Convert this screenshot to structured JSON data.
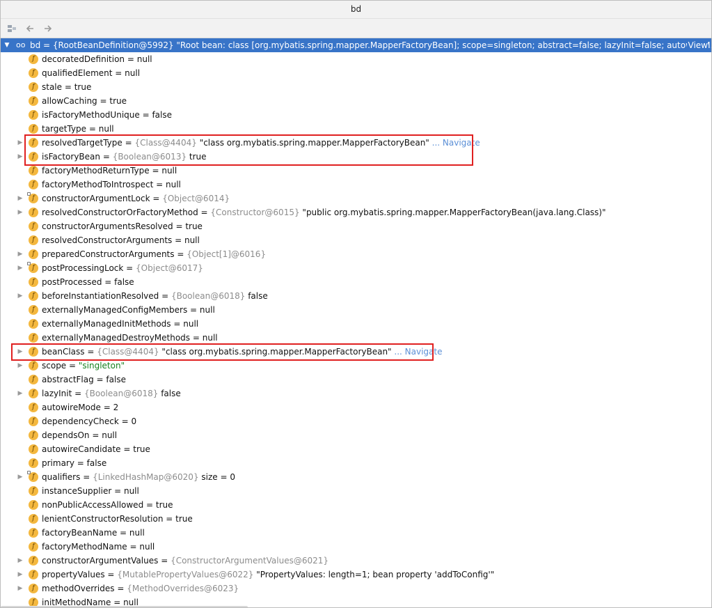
{
  "window": {
    "title": "bd"
  },
  "toolbar": {
    "buttons": [
      {
        "name": "restore-layout-icon"
      },
      {
        "name": "back-arrow-icon"
      },
      {
        "name": "forward-arrow-icon"
      }
    ]
  },
  "root": {
    "label": "bd = {RootBeanDefinition@5992} \"Root bean: class [org.mybatis.spring.mapper.MapperFactoryBean]; scope=singleton; abstract=false; lazyInit=false; autowireM...",
    "view": "View"
  },
  "fields": [
    {
      "name": "decoratedDefinition",
      "eq": " = ",
      "value": "null"
    },
    {
      "name": "qualifiedElement",
      "eq": " = ",
      "value": "null"
    },
    {
      "name": "stale",
      "eq": " = ",
      "value": "true"
    },
    {
      "name": "allowCaching",
      "eq": " = ",
      "value": "true"
    },
    {
      "name": "isFactoryMethodUnique",
      "eq": " = ",
      "value": "false"
    },
    {
      "name": "targetType",
      "eq": " = ",
      "value": "null"
    },
    {
      "name": "resolvedTargetType",
      "eq": " = ",
      "ref": "{Class@4404}",
      "value": " \"class org.mybatis.spring.mapper.MapperFactoryBean\"",
      "nav": " ... Navigate"
    },
    {
      "name": "isFactoryBean",
      "eq": " = ",
      "ref": "{Boolean@6013}",
      "value": " true"
    },
    {
      "name": "factoryMethodReturnType",
      "eq": " = ",
      "value": "null"
    },
    {
      "name": "factoryMethodToIntrospect",
      "eq": " = ",
      "value": "null"
    },
    {
      "name": "constructorArgumentLock",
      "eq": " = ",
      "ref": "{Object@6014}",
      "value": ""
    },
    {
      "name": "resolvedConstructorOrFactoryMethod",
      "eq": " = ",
      "ref": "{Constructor@6015}",
      "value": " \"public org.mybatis.spring.mapper.MapperFactoryBean(java.lang.Class)\""
    },
    {
      "name": "constructorArgumentsResolved",
      "eq": " = ",
      "value": "true"
    },
    {
      "name": "resolvedConstructorArguments",
      "eq": " = ",
      "value": "null"
    },
    {
      "name": "preparedConstructorArguments",
      "eq": " = ",
      "ref": "{Object[1]@6016}",
      "value": ""
    },
    {
      "name": "postProcessingLock",
      "eq": " = ",
      "ref": "{Object@6017}",
      "value": ""
    },
    {
      "name": "postProcessed",
      "eq": " = ",
      "value": "false"
    },
    {
      "name": "beforeInstantiationResolved",
      "eq": " = ",
      "ref": "{Boolean@6018}",
      "value": " false"
    },
    {
      "name": "externallyManagedConfigMembers",
      "eq": " = ",
      "value": "null"
    },
    {
      "name": "externallyManagedInitMethods",
      "eq": " = ",
      "value": "null"
    },
    {
      "name": "externallyManagedDestroyMethods",
      "eq": " = ",
      "value": "null"
    },
    {
      "name": "beanClass",
      "eq": " = ",
      "ref": "{Class@4404}",
      "value": " \"class org.mybatis.spring.mapper.MapperFactoryBean\"",
      "nav": " ... Navigate"
    },
    {
      "name": "scope",
      "eq": " = ",
      "str": "\"singleton\"",
      "value": ""
    },
    {
      "name": "abstractFlag",
      "eq": " = ",
      "value": "false"
    },
    {
      "name": "lazyInit",
      "eq": " = ",
      "ref": "{Boolean@6018}",
      "value": " false"
    },
    {
      "name": "autowireMode",
      "eq": " = ",
      "value": "2"
    },
    {
      "name": "dependencyCheck",
      "eq": " = ",
      "value": "0"
    },
    {
      "name": "dependsOn",
      "eq": " = ",
      "value": "null"
    },
    {
      "name": "autowireCandidate",
      "eq": " = ",
      "value": "true"
    },
    {
      "name": "primary",
      "eq": " = ",
      "value": "false"
    },
    {
      "name": "qualifiers",
      "eq": " = ",
      "ref": "{LinkedHashMap@6020}",
      "value": "  size = 0"
    },
    {
      "name": "instanceSupplier",
      "eq": " = ",
      "value": "null"
    },
    {
      "name": "nonPublicAccessAllowed",
      "eq": " = ",
      "value": "true"
    },
    {
      "name": "lenientConstructorResolution",
      "eq": " = ",
      "value": "true"
    },
    {
      "name": "factoryBeanName",
      "eq": " = ",
      "value": "null"
    },
    {
      "name": "factoryMethodName",
      "eq": " = ",
      "value": "null"
    },
    {
      "name": "constructorArgumentValues",
      "eq": " = ",
      "ref": "{ConstructorArgumentValues@6021}",
      "value": ""
    },
    {
      "name": "propertyValues",
      "eq": " = ",
      "ref": "{MutablePropertyValues@6022}",
      "value": " \"PropertyValues: length=1; bean property 'addToConfig'\""
    },
    {
      "name": "methodOverrides",
      "eq": " = ",
      "ref": "{MethodOverrides@6023}",
      "value": ""
    },
    {
      "name": "initMethodName",
      "eq": " = ",
      "value": "null"
    }
  ],
  "colors": {
    "selection": "#3874c8",
    "field_icon": "#f4b83f",
    "highlight_box": "#e02020",
    "ref_gray": "#8c8c8c",
    "string_green": "#16801e",
    "navigate_link": "#5b8fd6"
  }
}
